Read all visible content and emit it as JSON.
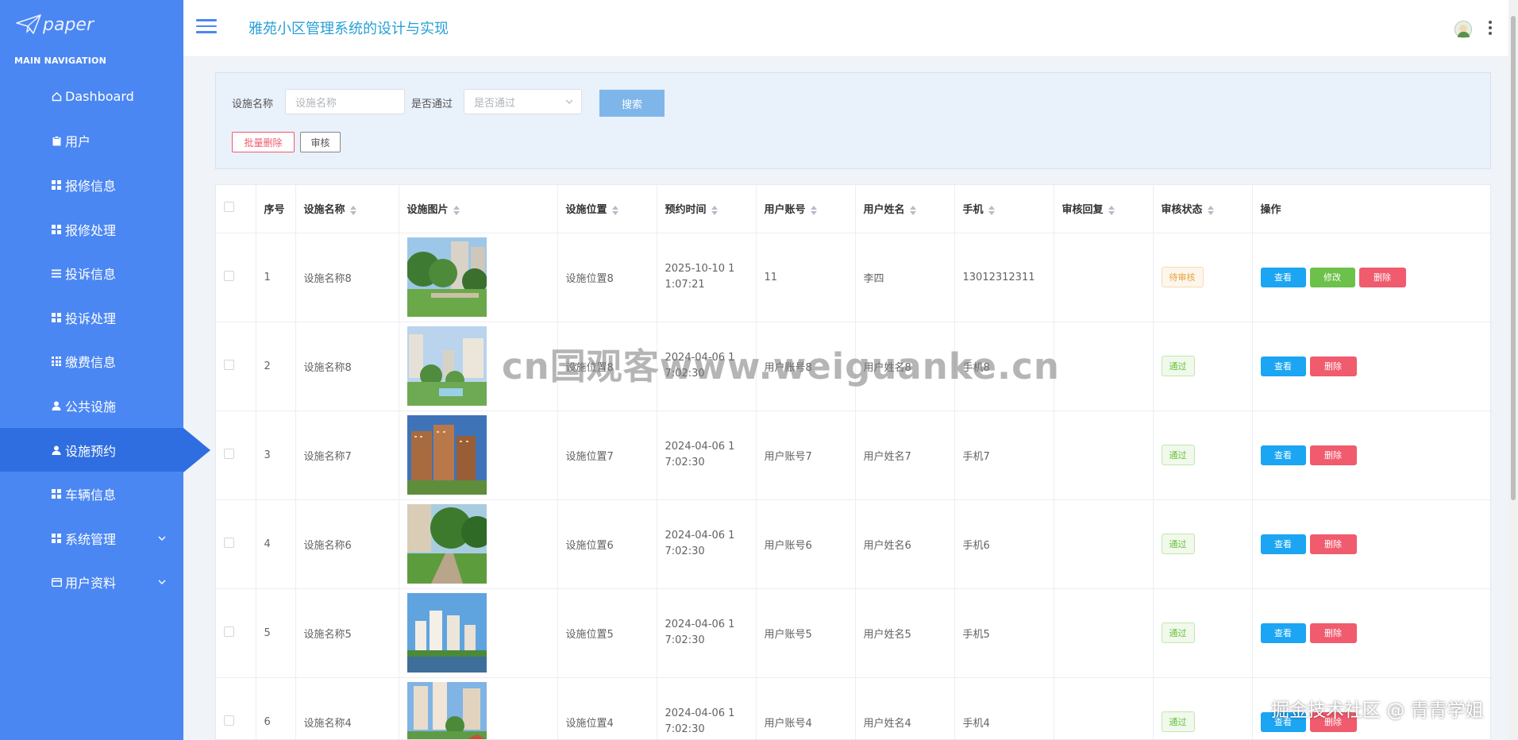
{
  "sidebar": {
    "logo_text": "paper",
    "nav_title": "MAIN NAVIGATION",
    "items": [
      {
        "label": "Dashboard",
        "icon": "home-icon"
      },
      {
        "label": "用户",
        "icon": "clipboard-icon"
      },
      {
        "label": "报修信息",
        "icon": "grid-icon"
      },
      {
        "label": "报修处理",
        "icon": "grid-icon"
      },
      {
        "label": "投诉信息",
        "icon": "list-icon"
      },
      {
        "label": "投诉处理",
        "icon": "grid-icon"
      },
      {
        "label": "缴费信息",
        "icon": "grid9-icon"
      },
      {
        "label": "公共设施",
        "icon": "user-icon"
      },
      {
        "label": "设施预约",
        "icon": "user-icon",
        "active": true
      },
      {
        "label": "车辆信息",
        "icon": "grid-icon"
      },
      {
        "label": "系统管理",
        "icon": "grid-icon",
        "expandable": true
      },
      {
        "label": "用户资料",
        "icon": "card-icon",
        "expandable": true
      }
    ]
  },
  "header": {
    "title": "雅苑小区管理系统的设计与实现"
  },
  "search": {
    "name_label": "设施名称",
    "name_placeholder": "设施名称",
    "pass_label": "是否通过",
    "pass_placeholder": "是否通过",
    "search_button": "搜索",
    "batch_delete": "批量删除",
    "audit": "审核"
  },
  "table": {
    "columns": [
      "序号",
      "设施名称",
      "设施图片",
      "设施位置",
      "预约时间",
      "用户账号",
      "用户姓名",
      "手机",
      "审核回复",
      "审核状态",
      "操作"
    ],
    "rows": [
      {
        "no": "1",
        "name": "设施名称8",
        "location": "设施位置8",
        "time": "2025-10-10 11:07:21",
        "account": "11",
        "username": "李四",
        "phone": "13012312311",
        "reply": "",
        "status": "待审核",
        "status_type": "pending",
        "actions": [
          "查看",
          "修改",
          "删除"
        ]
      },
      {
        "no": "2",
        "name": "设施名称8",
        "location": "设施位置8",
        "time": "2024-04-06 17:02:30",
        "account": "用户账号8",
        "username": "用户姓名8",
        "phone": "手机8",
        "reply": "",
        "status": "通过",
        "status_type": "pass",
        "actions": [
          "查看",
          "删除"
        ]
      },
      {
        "no": "3",
        "name": "设施名称7",
        "location": "设施位置7",
        "time": "2024-04-06 17:02:30",
        "account": "用户账号7",
        "username": "用户姓名7",
        "phone": "手机7",
        "reply": "",
        "status": "通过",
        "status_type": "pass",
        "actions": [
          "查看",
          "删除"
        ]
      },
      {
        "no": "4",
        "name": "设施名称6",
        "location": "设施位置6",
        "time": "2024-04-06 17:02:30",
        "account": "用户账号6",
        "username": "用户姓名6",
        "phone": "手机6",
        "reply": "",
        "status": "通过",
        "status_type": "pass",
        "actions": [
          "查看",
          "删除"
        ]
      },
      {
        "no": "5",
        "name": "设施名称5",
        "location": "设施位置5",
        "time": "2024-04-06 17:02:30",
        "account": "用户账号5",
        "username": "用户姓名5",
        "phone": "手机5",
        "reply": "",
        "status": "通过",
        "status_type": "pass",
        "actions": [
          "查看",
          "删除"
        ]
      },
      {
        "no": "6",
        "name": "设施名称4",
        "location": "设施位置4",
        "time": "2024-04-06 17:02:30",
        "account": "用户账号4",
        "username": "用户姓名4",
        "phone": "手机4",
        "reply": "",
        "status": "通过",
        "status_type": "pass",
        "actions": [
          "查看",
          "删除"
        ]
      }
    ]
  },
  "watermark": {
    "center": "cn国观客www.weiguanke.cn",
    "corner": "掘金技术社区 @ 青青学姐"
  },
  "colors": {
    "sidebar_bg": "#4b87f3",
    "sidebar_active": "#2f6ee0",
    "title": "#28a0d7",
    "view_btn": "#1ba5f3",
    "edit_btn": "#6cc14a",
    "delete_btn": "#f05b6e"
  }
}
